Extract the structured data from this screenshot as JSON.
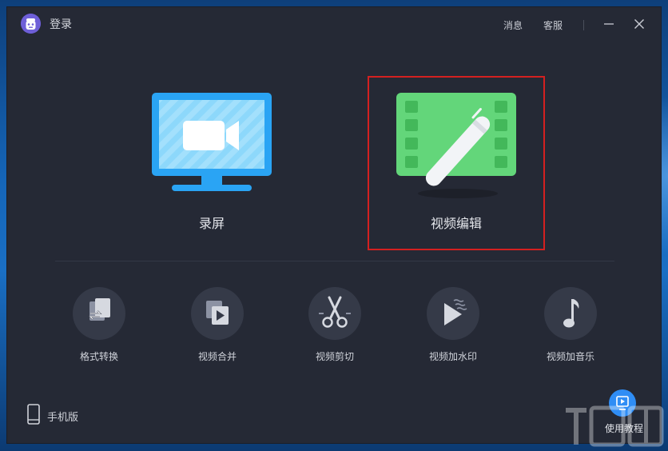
{
  "titlebar": {
    "login_label": "登录",
    "messages_label": "消息",
    "service_label": "客服"
  },
  "main": {
    "record_label": "录屏",
    "edit_label": "视频编辑"
  },
  "tools": [
    {
      "label": "格式转换",
      "icon": "format-convert-icon"
    },
    {
      "label": "视频合并",
      "icon": "video-merge-icon"
    },
    {
      "label": "视频剪切",
      "icon": "scissors-icon"
    },
    {
      "label": "视频加水印",
      "icon": "watermark-icon"
    },
    {
      "label": "视频加音乐",
      "icon": "music-note-icon"
    }
  ],
  "footer": {
    "mobile_label": "手机版",
    "tutorial_label": "使用教程"
  },
  "colors": {
    "window_bg": "#252935",
    "record_blue": "#2aa4f4",
    "edit_green": "#63d67a",
    "highlight_red": "#d42020",
    "tutorial_blue": "#2f8df5"
  }
}
